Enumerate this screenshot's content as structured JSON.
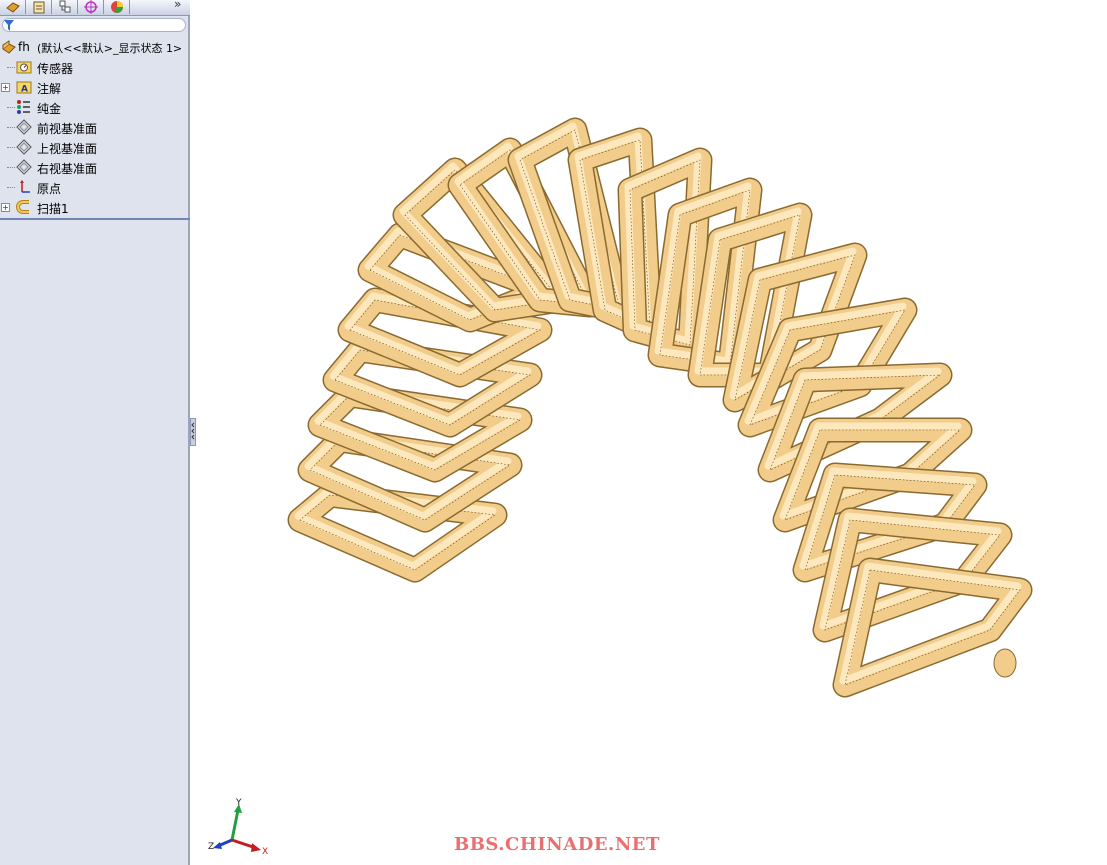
{
  "feature_tree": {
    "root": {
      "name": "fh",
      "config": "(默认<<默认>_显示状态 1>"
    },
    "items": [
      {
        "label": "传感器",
        "icon": "sensor-folder-icon"
      },
      {
        "label": "注解",
        "icon": "annotation-folder-icon"
      },
      {
        "label": "纯金",
        "icon": "material-icon"
      },
      {
        "label": "前视基准面",
        "icon": "plane-icon"
      },
      {
        "label": "上视基准面",
        "icon": "plane-icon"
      },
      {
        "label": "右视基准面",
        "icon": "plane-icon"
      },
      {
        "label": "原点",
        "icon": "origin-icon"
      },
      {
        "label": "扫描1",
        "icon": "sweep-feature-icon"
      }
    ]
  },
  "tabs": [
    "feature-manager",
    "property-manager",
    "configuration-manager",
    "dimxpert-manager",
    "display-manager"
  ],
  "triad": {
    "axes": [
      "Y",
      "Z",
      "X"
    ]
  },
  "watermark": "BBS.CHINADE.NET",
  "colors": {
    "spring_fill": "#f2cc8a",
    "spring_shadow": "#c9a060",
    "spring_edge": "#5a4420",
    "panel_bg": "#dfe3ee",
    "watermark": "#e87070"
  }
}
